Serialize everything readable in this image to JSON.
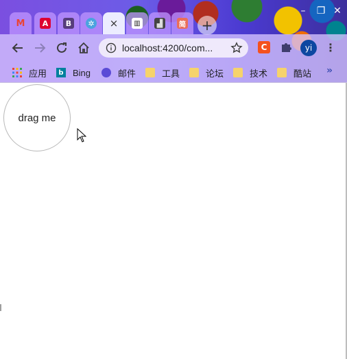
{
  "tabs": [
    {
      "name": "tab-gmail",
      "glyph": "M",
      "color": "#ea4335",
      "active": false
    },
    {
      "name": "tab-angular",
      "glyph": "A",
      "color": "#dd0031",
      "active": false
    },
    {
      "name": "tab-bootstrap",
      "glyph": "B",
      "color": "#563d7c",
      "active": false
    },
    {
      "name": "tab-settings",
      "glyph": "✲",
      "color": "#4aa3df",
      "active": false
    },
    {
      "name": "tab-active",
      "glyph": "×",
      "color": "",
      "active": true
    },
    {
      "name": "tab-reader",
      "glyph": "📖",
      "color": "#222",
      "active": false
    },
    {
      "name": "tab-dark",
      "glyph": "▟",
      "color": "#333",
      "active": false
    },
    {
      "name": "tab-jianshu",
      "glyph": "简",
      "color": "#ea6f5a",
      "active": false
    }
  ],
  "address_bar": {
    "url": "localhost:4200/com..."
  },
  "extensions": {
    "c_label": "C",
    "avatar_label": "yi"
  },
  "bookmarks": {
    "apps": "应用",
    "bing": "Bing",
    "mail": "邮件",
    "tools": "工具",
    "forum": "论坛",
    "tech": "技术",
    "kuzhan": "酷站",
    "more": "»"
  },
  "page": {
    "drag_label": "drag me"
  }
}
